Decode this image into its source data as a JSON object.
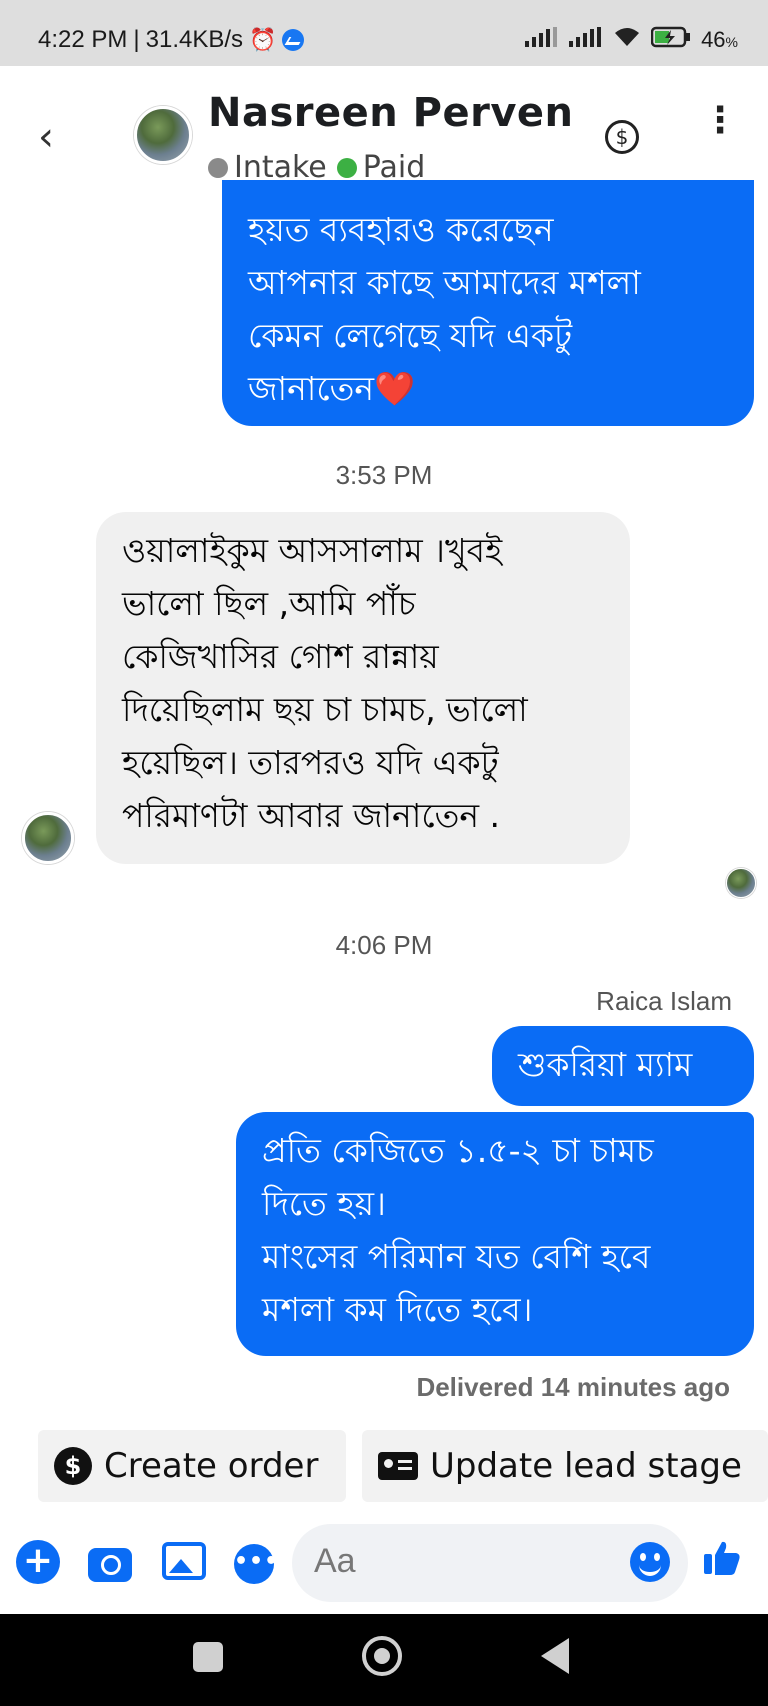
{
  "status_bar": {
    "time": "4:22 PM",
    "speed": "31.4KB/s",
    "battery": "46",
    "battery_unit": "%"
  },
  "header": {
    "contact_name": "Nasreen Perven",
    "tags": [
      {
        "label": "Intake",
        "color": "#8a8a8a"
      },
      {
        "label": "Paid",
        "color": "#3cb043"
      }
    ]
  },
  "messages": {
    "out_partial": "হয়ত ব্যবহারও করেছেন\nআপনার কাছে আমাদের মশলা\nকেমন লেগেছে যদি একটু\nজানাতেন❤️",
    "time_1": "3:53 PM",
    "in_1": "ওয়ালাইকুম আসসালাম ।খুবই\nভালো ছিল ,আমি পাঁচ\nকেজিখাসির গোশ রান্নায়\nদিয়েছিলাম ছয় চা চামচ, ভালো\nহয়েছিল। তারপরও যদি একটু\nপরিমাণটা আবার  জানাতেন .",
    "time_2": "4:06 PM",
    "sender_name": "Raica Islam",
    "out_2": "শুকরিয়া ম্যাম",
    "out_3": "প্রতি কেজিতে ১.৫-২ চা চামচ\nদিতে হয়।\nমাংসের পরিমান যত বেশি হবে\nমশলা কম দিতে হবে।",
    "delivered": "Delivered 14 minutes ago"
  },
  "actions": {
    "create_order": "Create order",
    "update_lead_stage": "Update lead stage"
  },
  "composer": {
    "placeholder": "Aa"
  },
  "colors": {
    "accent": "#0a6cf5",
    "incoming_bubble": "#f0f0f0"
  }
}
